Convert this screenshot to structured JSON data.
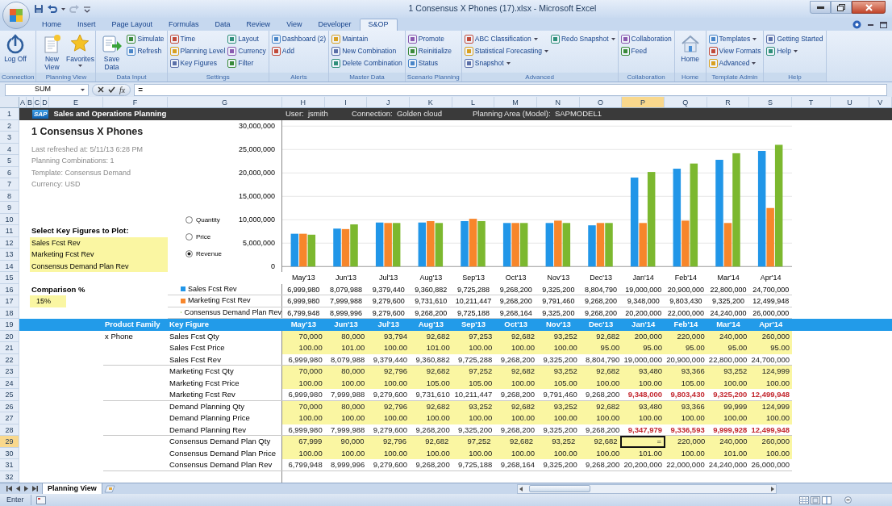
{
  "window": {
    "title": "1 Consensus X Phones (17).xlsx - Microsoft Excel"
  },
  "ribbon_tabs": [
    {
      "label": "Home",
      "selected": false
    },
    {
      "label": "Insert",
      "selected": false
    },
    {
      "label": "Page Layout",
      "selected": false
    },
    {
      "label": "Formulas",
      "selected": false
    },
    {
      "label": "Data",
      "selected": false
    },
    {
      "label": "Review",
      "selected": false
    },
    {
      "label": "View",
      "selected": false
    },
    {
      "label": "Developer",
      "selected": false
    },
    {
      "label": "S&OP",
      "selected": true
    }
  ],
  "ribbon_groups": [
    {
      "label": "Connection",
      "items": [
        {
          "label": "Log Off",
          "kind": "large",
          "dropdown": false
        }
      ]
    },
    {
      "label": "Planning View",
      "items": [
        {
          "label": "New View",
          "kind": "large",
          "dropdown": false
        },
        {
          "label": "Favorites",
          "kind": "large",
          "dropdown": true
        }
      ]
    },
    {
      "label": "Data Input",
      "items": [
        {
          "label": "Save Data",
          "kind": "large",
          "dropdown": false
        },
        {
          "label": "Simulate",
          "kind": "small",
          "dropdown": false
        },
        {
          "label": "Refresh",
          "kind": "small",
          "dropdown": false
        }
      ]
    },
    {
      "label": "Settings",
      "items": [
        {
          "label": "Time",
          "kind": "small",
          "dropdown": false
        },
        {
          "label": "Planning Level",
          "kind": "small",
          "dropdown": false
        },
        {
          "label": "Key Figures",
          "kind": "small",
          "dropdown": false
        },
        {
          "label": "Layout",
          "kind": "small",
          "dropdown": false
        },
        {
          "label": "Currency",
          "kind": "small",
          "dropdown": false
        },
        {
          "label": "Filter",
          "kind": "small",
          "dropdown": false
        }
      ]
    },
    {
      "label": "Alerts",
      "items": [
        {
          "label": "Dashboard (2)",
          "kind": "small",
          "dropdown": false
        },
        {
          "label": "Add",
          "kind": "small",
          "dropdown": false
        }
      ]
    },
    {
      "label": "Master Data",
      "items": [
        {
          "label": "Maintain",
          "kind": "small",
          "dropdown": false
        },
        {
          "label": "New Combination",
          "kind": "small",
          "dropdown": false
        },
        {
          "label": "Delete Combination",
          "kind": "small",
          "dropdown": false
        }
      ]
    },
    {
      "label": "Scenario Planning",
      "items": [
        {
          "label": "Promote",
          "kind": "small",
          "dropdown": false
        },
        {
          "label": "Reinitialize",
          "kind": "small",
          "dropdown": false
        },
        {
          "label": "Status",
          "kind": "small",
          "dropdown": false
        }
      ]
    },
    {
      "label": "Advanced",
      "items": [
        {
          "label": "ABC Classification",
          "kind": "small",
          "dropdown": true
        },
        {
          "label": "Statistical Forecasting",
          "kind": "small",
          "dropdown": true
        },
        {
          "label": "Snapshot",
          "kind": "small",
          "dropdown": true
        },
        {
          "label": "Redo Snapshot",
          "kind": "small",
          "dropdown": true
        }
      ]
    },
    {
      "label": "Collaboration",
      "items": [
        {
          "label": "Collaboration",
          "kind": "small",
          "dropdown": false
        },
        {
          "label": "Feed",
          "kind": "small",
          "dropdown": false
        }
      ]
    },
    {
      "label": "Home",
      "items": [
        {
          "label": "Home",
          "kind": "large",
          "dropdown": false
        }
      ]
    },
    {
      "label": "Template Admin",
      "items": [
        {
          "label": "Templates",
          "kind": "small",
          "dropdown": true
        },
        {
          "label": "View Formats",
          "kind": "small",
          "dropdown": false
        },
        {
          "label": "Advanced",
          "kind": "small",
          "dropdown": true
        }
      ]
    },
    {
      "label": "Help",
      "items": [
        {
          "label": "Getting Started",
          "kind": "small",
          "dropdown": false
        },
        {
          "label": "Help",
          "kind": "small",
          "dropdown": true
        }
      ]
    }
  ],
  "formula_bar": {
    "name_box": "SUM",
    "function_button": "fx",
    "value": "="
  },
  "column_headers": [
    {
      "label": "A",
      "selected": false
    },
    {
      "label": "B",
      "selected": false
    },
    {
      "label": "C",
      "selected": false
    },
    {
      "label": "D",
      "selected": false
    },
    {
      "label": "E",
      "selected": false
    },
    {
      "label": "F",
      "selected": false
    },
    {
      "label": "G",
      "selected": false
    },
    {
      "label": "H",
      "selected": false
    },
    {
      "label": "I",
      "selected": false
    },
    {
      "label": "J",
      "selected": false
    },
    {
      "label": "K",
      "selected": false
    },
    {
      "label": "L",
      "selected": false
    },
    {
      "label": "M",
      "selected": false
    },
    {
      "label": "N",
      "selected": false
    },
    {
      "label": "O",
      "selected": false
    },
    {
      "label": "P",
      "selected": true
    },
    {
      "label": "Q",
      "selected": false
    },
    {
      "label": "R",
      "selected": false
    },
    {
      "label": "S",
      "selected": false
    },
    {
      "label": "T",
      "selected": false
    },
    {
      "label": "U",
      "selected": false
    },
    {
      "label": "V",
      "selected": false
    }
  ],
  "row_headers": [
    {
      "label": "1",
      "selected": false
    },
    {
      "label": "2",
      "selected": false
    },
    {
      "label": "3",
      "selected": false
    },
    {
      "label": "4",
      "selected": false
    },
    {
      "label": "5",
      "selected": false
    },
    {
      "label": "6",
      "selected": false
    },
    {
      "label": "7",
      "selected": false
    },
    {
      "label": "8",
      "selected": false
    },
    {
      "label": "9",
      "selected": false
    },
    {
      "label": "10",
      "selected": false
    },
    {
      "label": "11",
      "selected": false
    },
    {
      "label": "12",
      "selected": false
    },
    {
      "label": "13",
      "selected": false
    },
    {
      "label": "14",
      "selected": false
    },
    {
      "label": "15",
      "selected": false
    },
    {
      "label": "16",
      "selected": false
    },
    {
      "label": "17",
      "selected": false
    },
    {
      "label": "18",
      "selected": false
    },
    {
      "label": "19",
      "selected": false
    },
    {
      "label": "20",
      "selected": false
    },
    {
      "label": "21",
      "selected": false
    },
    {
      "label": "22",
      "selected": false
    },
    {
      "label": "23",
      "selected": false
    },
    {
      "label": "24",
      "selected": false
    },
    {
      "label": "25",
      "selected": false
    },
    {
      "label": "26",
      "selected": false
    },
    {
      "label": "27",
      "selected": false
    },
    {
      "label": "28",
      "selected": false
    },
    {
      "label": "29",
      "selected": true
    },
    {
      "label": "30",
      "selected": false
    },
    {
      "label": "31",
      "selected": false
    },
    {
      "label": "32",
      "selected": false
    }
  ],
  "sheet": {
    "banner": {
      "logo": "SAP",
      "title": "Sales and Operations Planning",
      "user": "User:  jsmith",
      "connection": "Connection:  Golden cloud",
      "planning_area": "Planning Area (Model):  SAPMODEL1"
    },
    "title": "1 Consensus X Phones",
    "details": [
      "Last refreshed at: 5/11/13 6:28 PM",
      "Planning Combinations: 1",
      "Template: Consensus Demand",
      "Currency: USD"
    ],
    "key_figure_selector": {
      "label": "Select Key Figures to Plot:",
      "items": [
        "Sales Fcst Rev",
        "Marketing Fcst Rev",
        "Consensus Demand Plan Rev"
      ]
    },
    "comparison": {
      "label": "Comparison %",
      "value": "15%"
    },
    "plot_options": [
      {
        "label": "Quantity",
        "selected": false
      },
      {
        "label": "Price",
        "selected": false
      },
      {
        "label": "Revenue",
        "selected": true
      }
    ],
    "chart_data": {
      "type": "bar",
      "categories": [
        "May'13",
        "Jun'13",
        "Jul'13",
        "Aug'13",
        "Sep'13",
        "Oct'13",
        "Nov'13",
        "Dec'13",
        "Jan'14",
        "Feb'14",
        "Mar'14",
        "Apr'14"
      ],
      "series": [
        {
          "name": "Sales Fcst Rev",
          "color": "#2196e8",
          "values": [
            7000000,
            8100000,
            9400000,
            9400000,
            9700000,
            9300000,
            9300000,
            8800000,
            19000000,
            20900000,
            22800000,
            24700000
          ]
        },
        {
          "name": "Marketing Fcst Rev",
          "color": "#f7862b",
          "values": [
            7000000,
            8000000,
            9300000,
            9700000,
            10200000,
            9300000,
            9800000,
            9300000,
            9300000,
            9800000,
            9300000,
            12500000
          ]
        },
        {
          "name": "Consensus Demand Plan Rev",
          "color": "#7cb82f",
          "values": [
            6800000,
            9000000,
            9300000,
            9300000,
            9700000,
            9300000,
            9300000,
            9300000,
            20200000,
            22000000,
            24200000,
            26000000
          ]
        }
      ],
      "ylim": [
        0,
        30000000
      ],
      "grid": true,
      "yticks": [
        {
          "value": 0,
          "label": "0"
        },
        {
          "value": 5000000,
          "label": "5,000,000"
        },
        {
          "value": 10000000,
          "label": "10,000,000"
        },
        {
          "value": 15000000,
          "label": "15,000,000"
        },
        {
          "value": 20000000,
          "label": "20,000,000"
        },
        {
          "value": 25000000,
          "label": "25,000,000"
        },
        {
          "value": 30000000,
          "label": "30,000,000"
        }
      ]
    },
    "chart_table": [
      {
        "values": [
          "6,999,980",
          "8,079,988",
          "9,379,440",
          "9,360,882",
          "9,725,288",
          "9,268,200",
          "9,325,200",
          "8,804,790",
          "19,000,000",
          "20,900,000",
          "22,800,000",
          "24,700,000"
        ]
      },
      {
        "values": [
          "6,999,980",
          "7,999,988",
          "9,279,600",
          "9,731,610",
          "10,211,447",
          "9,268,200",
          "9,791,460",
          "9,268,200",
          "9,348,000",
          "9,803,430",
          "9,325,200",
          "12,499,948"
        ]
      },
      {
        "values": [
          "6,799,948",
          "8,999,996",
          "9,279,600",
          "9,268,200",
          "9,725,188",
          "9,268,164",
          "9,325,200",
          "9,268,200",
          "20,200,000",
          "22,000,000",
          "24,240,000",
          "26,000,000"
        ]
      }
    ],
    "planning_table": {
      "product_family_header": "Product Family",
      "key_figure_header": "Key Figure",
      "periods": [
        "May'13",
        "Jun'13",
        "Jul'13",
        "Aug'13",
        "Sep'13",
        "Oct'13",
        "Nov'13",
        "Dec'13",
        "Jan'14",
        "Feb'14",
        "Mar'14",
        "Apr'14"
      ],
      "groups": [
        {
          "product_family": "x Phone",
          "rows": [
            {
              "key_figure": "Sales Fcst Qty",
              "kind": "input",
              "cells": [
                {
                  "text": "70,000",
                  "alert": false,
                  "selected": false
                },
                {
                  "text": "80,000",
                  "alert": false,
                  "selected": false
                },
                {
                  "text": "93,794",
                  "alert": false,
                  "selected": false
                },
                {
                  "text": "92,682",
                  "alert": false,
                  "selected": false
                },
                {
                  "text": "97,253",
                  "alert": false,
                  "selected": false
                },
                {
                  "text": "92,682",
                  "alert": false,
                  "selected": false
                },
                {
                  "text": "93,252",
                  "alert": false,
                  "selected": false
                },
                {
                  "text": "92,682",
                  "alert": false,
                  "selected": false
                },
                {
                  "text": "200,000",
                  "alert": false,
                  "selected": false
                },
                {
                  "text": "220,000",
                  "alert": false,
                  "selected": false
                },
                {
                  "text": "240,000",
                  "alert": false,
                  "selected": false
                },
                {
                  "text": "260,000",
                  "alert": false,
                  "selected": false
                }
              ]
            },
            {
              "key_figure": "Sales Fcst Price",
              "kind": "input",
              "cells": [
                {
                  "text": "100.00",
                  "alert": false,
                  "selected": false
                },
                {
                  "text": "101.00",
                  "alert": false,
                  "selected": false
                },
                {
                  "text": "100.00",
                  "alert": false,
                  "selected": false
                },
                {
                  "text": "101.00",
                  "alert": false,
                  "selected": false
                },
                {
                  "text": "100.00",
                  "alert": false,
                  "selected": false
                },
                {
                  "text": "100.00",
                  "alert": false,
                  "selected": false
                },
                {
                  "text": "100.00",
                  "alert": false,
                  "selected": false
                },
                {
                  "text": "95.00",
                  "alert": false,
                  "selected": false
                },
                {
                  "text": "95.00",
                  "alert": false,
                  "selected": false
                },
                {
                  "text": "95.00",
                  "alert": false,
                  "selected": false
                },
                {
                  "text": "95.00",
                  "alert": false,
                  "selected": false
                },
                {
                  "text": "95.00",
                  "alert": false,
                  "selected": false
                }
              ]
            },
            {
              "key_figure": "Sales Fcst Rev",
              "kind": "calc",
              "cells": [
                {
                  "text": "6,999,980",
                  "alert": false,
                  "selected": false
                },
                {
                  "text": "8,079,988",
                  "alert": false,
                  "selected": false
                },
                {
                  "text": "9,379,440",
                  "alert": false,
                  "selected": false
                },
                {
                  "text": "9,360,882",
                  "alert": false,
                  "selected": false
                },
                {
                  "text": "9,725,288",
                  "alert": false,
                  "selected": false
                },
                {
                  "text": "9,268,200",
                  "alert": false,
                  "selected": false
                },
                {
                  "text": "9,325,200",
                  "alert": false,
                  "selected": false
                },
                {
                  "text": "8,804,790",
                  "alert": false,
                  "selected": false
                },
                {
                  "text": "19,000,000",
                  "alert": false,
                  "selected": false
                },
                {
                  "text": "20,900,000",
                  "alert": false,
                  "selected": false
                },
                {
                  "text": "22,800,000",
                  "alert": false,
                  "selected": false
                },
                {
                  "text": "24,700,000",
                  "alert": false,
                  "selected": false
                }
              ]
            }
          ]
        },
        {
          "rows": [
            {
              "key_figure": "Marketing Fcst Qty",
              "kind": "input",
              "cells": [
                {
                  "text": "70,000",
                  "alert": false,
                  "selected": false
                },
                {
                  "text": "80,000",
                  "alert": false,
                  "selected": false
                },
                {
                  "text": "92,796",
                  "alert": false,
                  "selected": false
                },
                {
                  "text": "92,682",
                  "alert": false,
                  "selected": false
                },
                {
                  "text": "97,252",
                  "alert": false,
                  "selected": false
                },
                {
                  "text": "92,682",
                  "alert": false,
                  "selected": false
                },
                {
                  "text": "93,252",
                  "alert": false,
                  "selected": false
                },
                {
                  "text": "92,682",
                  "alert": false,
                  "selected": false
                },
                {
                  "text": "93,480",
                  "alert": false,
                  "selected": false
                },
                {
                  "text": "93,366",
                  "alert": false,
                  "selected": false
                },
                {
                  "text": "93,252",
                  "alert": false,
                  "selected": false
                },
                {
                  "text": "124,999",
                  "alert": false,
                  "selected": false
                }
              ]
            },
            {
              "key_figure": "Marketing Fcst Price",
              "kind": "input",
              "cells": [
                {
                  "text": "100.00",
                  "alert": false,
                  "selected": false
                },
                {
                  "text": "100.00",
                  "alert": false,
                  "selected": false
                },
                {
                  "text": "100.00",
                  "alert": false,
                  "selected": false
                },
                {
                  "text": "105.00",
                  "alert": false,
                  "selected": false
                },
                {
                  "text": "105.00",
                  "alert": false,
                  "selected": false
                },
                {
                  "text": "100.00",
                  "alert": false,
                  "selected": false
                },
                {
                  "text": "105.00",
                  "alert": false,
                  "selected": false
                },
                {
                  "text": "100.00",
                  "alert": false,
                  "selected": false
                },
                {
                  "text": "100.00",
                  "alert": false,
                  "selected": false
                },
                {
                  "text": "105.00",
                  "alert": false,
                  "selected": false
                },
                {
                  "text": "100.00",
                  "alert": false,
                  "selected": false
                },
                {
                  "text": "100.00",
                  "alert": false,
                  "selected": false
                }
              ]
            },
            {
              "key_figure": "Marketing Fcst Rev",
              "kind": "calc",
              "cells": [
                {
                  "text": "6,999,980",
                  "alert": false,
                  "selected": false
                },
                {
                  "text": "7,999,988",
                  "alert": false,
                  "selected": false
                },
                {
                  "text": "9,279,600",
                  "alert": false,
                  "selected": false
                },
                {
                  "text": "9,731,610",
                  "alert": false,
                  "selected": false
                },
                {
                  "text": "10,211,447",
                  "alert": false,
                  "selected": false
                },
                {
                  "text": "9,268,200",
                  "alert": false,
                  "selected": false
                },
                {
                  "text": "9,791,460",
                  "alert": false,
                  "selected": false
                },
                {
                  "text": "9,268,200",
                  "alert": false,
                  "selected": false
                },
                {
                  "text": "9,348,000",
                  "alert": true,
                  "selected": false
                },
                {
                  "text": "9,803,430",
                  "alert": true,
                  "selected": false
                },
                {
                  "text": "9,325,200",
                  "alert": true,
                  "selected": false
                },
                {
                  "text": "12,499,948",
                  "alert": true,
                  "selected": false
                }
              ]
            }
          ]
        },
        {
          "rows": [
            {
              "key_figure": "Demand Planning Qty",
              "kind": "input",
              "cells": [
                {
                  "text": "70,000",
                  "alert": false,
                  "selected": false
                },
                {
                  "text": "80,000",
                  "alert": false,
                  "selected": false
                },
                {
                  "text": "92,796",
                  "alert": false,
                  "selected": false
                },
                {
                  "text": "92,682",
                  "alert": false,
                  "selected": false
                },
                {
                  "text": "93,252",
                  "alert": false,
                  "selected": false
                },
                {
                  "text": "92,682",
                  "alert": false,
                  "selected": false
                },
                {
                  "text": "93,252",
                  "alert": false,
                  "selected": false
                },
                {
                  "text": "92,682",
                  "alert": false,
                  "selected": false
                },
                {
                  "text": "93,480",
                  "alert": false,
                  "selected": false
                },
                {
                  "text": "93,366",
                  "alert": false,
                  "selected": false
                },
                {
                  "text": "99,999",
                  "alert": false,
                  "selected": false
                },
                {
                  "text": "124,999",
                  "alert": false,
                  "selected": false
                }
              ]
            },
            {
              "key_figure": "Demand Planning Price",
              "kind": "input",
              "cells": [
                {
                  "text": "100.00",
                  "alert": false,
                  "selected": false
                },
                {
                  "text": "100.00",
                  "alert": false,
                  "selected": false
                },
                {
                  "text": "100.00",
                  "alert": false,
                  "selected": false
                },
                {
                  "text": "100.00",
                  "alert": false,
                  "selected": false
                },
                {
                  "text": "100.00",
                  "alert": false,
                  "selected": false
                },
                {
                  "text": "100.00",
                  "alert": false,
                  "selected": false
                },
                {
                  "text": "100.00",
                  "alert": false,
                  "selected": false
                },
                {
                  "text": "100.00",
                  "alert": false,
                  "selected": false
                },
                {
                  "text": "100.00",
                  "alert": false,
                  "selected": false
                },
                {
                  "text": "100.00",
                  "alert": false,
                  "selected": false
                },
                {
                  "text": "100.00",
                  "alert": false,
                  "selected": false
                },
                {
                  "text": "100.00",
                  "alert": false,
                  "selected": false
                }
              ]
            },
            {
              "key_figure": "Demand Planning Rev",
              "kind": "calc",
              "cells": [
                {
                  "text": "6,999,980",
                  "alert": false,
                  "selected": false
                },
                {
                  "text": "7,999,988",
                  "alert": false,
                  "selected": false
                },
                {
                  "text": "9,279,600",
                  "alert": false,
                  "selected": false
                },
                {
                  "text": "9,268,200",
                  "alert": false,
                  "selected": false
                },
                {
                  "text": "9,325,200",
                  "alert": false,
                  "selected": false
                },
                {
                  "text": "9,268,200",
                  "alert": false,
                  "selected": false
                },
                {
                  "text": "9,325,200",
                  "alert": false,
                  "selected": false
                },
                {
                  "text": "9,268,200",
                  "alert": false,
                  "selected": false
                },
                {
                  "text": "9,347,979",
                  "alert": true,
                  "selected": false
                },
                {
                  "text": "9,336,593",
                  "alert": true,
                  "selected": false
                },
                {
                  "text": "9,999,928",
                  "alert": true,
                  "selected": false
                },
                {
                  "text": "12,499,948",
                  "alert": true,
                  "selected": false
                }
              ]
            }
          ]
        },
        {
          "rows": [
            {
              "key_figure": "Consensus Demand Plan Qty",
              "kind": "input",
              "cells": [
                {
                  "text": "67,999",
                  "alert": false,
                  "selected": false
                },
                {
                  "text": "90,000",
                  "alert": false,
                  "selected": false
                },
                {
                  "text": "92,796",
                  "alert": false,
                  "selected": false
                },
                {
                  "text": "92,682",
                  "alert": false,
                  "selected": false
                },
                {
                  "text": "97,252",
                  "alert": false,
                  "selected": false
                },
                {
                  "text": "92,682",
                  "alert": false,
                  "selected": false
                },
                {
                  "text": "93,252",
                  "alert": false,
                  "selected": false
                },
                {
                  "text": "92,682",
                  "alert": false,
                  "selected": false
                },
                {
                  "text": "=",
                  "alert": false,
                  "selected": true
                },
                {
                  "text": "220,000",
                  "alert": false,
                  "selected": false
                },
                {
                  "text": "240,000",
                  "alert": false,
                  "selected": false
                },
                {
                  "text": "260,000",
                  "alert": false,
                  "selected": false
                }
              ]
            },
            {
              "key_figure": "Consensus Demand Plan Price",
              "kind": "input",
              "cells": [
                {
                  "text": "100.00",
                  "alert": false,
                  "selected": false
                },
                {
                  "text": "100.00",
                  "alert": false,
                  "selected": false
                },
                {
                  "text": "100.00",
                  "alert": false,
                  "selected": false
                },
                {
                  "text": "100.00",
                  "alert": false,
                  "selected": false
                },
                {
                  "text": "100.00",
                  "alert": false,
                  "selected": false
                },
                {
                  "text": "100.00",
                  "alert": false,
                  "selected": false
                },
                {
                  "text": "100.00",
                  "alert": false,
                  "selected": false
                },
                {
                  "text": "100.00",
                  "alert": false,
                  "selected": false
                },
                {
                  "text": "101.00",
                  "alert": false,
                  "selected": false
                },
                {
                  "text": "100.00",
                  "alert": false,
                  "selected": false
                },
                {
                  "text": "101.00",
                  "alert": false,
                  "selected": false
                },
                {
                  "text": "100.00",
                  "alert": false,
                  "selected": false
                }
              ]
            },
            {
              "key_figure": "Consensus Demand Plan Rev",
              "kind": "calc",
              "cells": [
                {
                  "text": "6,799,948",
                  "alert": false,
                  "selected": false
                },
                {
                  "text": "8,999,996",
                  "alert": false,
                  "selected": false
                },
                {
                  "text": "9,279,600",
                  "alert": false,
                  "selected": false
                },
                {
                  "text": "9,268,200",
                  "alert": false,
                  "selected": false
                },
                {
                  "text": "9,725,188",
                  "alert": false,
                  "selected": false
                },
                {
                  "text": "9,268,164",
                  "alert": false,
                  "selected": false
                },
                {
                  "text": "9,325,200",
                  "alert": false,
                  "selected": false
                },
                {
                  "text": "9,268,200",
                  "alert": false,
                  "selected": false
                },
                {
                  "text": "20,200,000",
                  "alert": false,
                  "selected": false
                },
                {
                  "text": "22,000,000",
                  "alert": false,
                  "selected": false
                },
                {
                  "text": "24,240,000",
                  "alert": false,
                  "selected": false
                },
                {
                  "text": "26,000,000",
                  "alert": false,
                  "selected": false
                }
              ]
            }
          ]
        }
      ]
    }
  },
  "sheet_tabs": [
    {
      "label": "Planning View",
      "selected": true
    }
  ],
  "status_bar": {
    "mode": "Enter"
  }
}
